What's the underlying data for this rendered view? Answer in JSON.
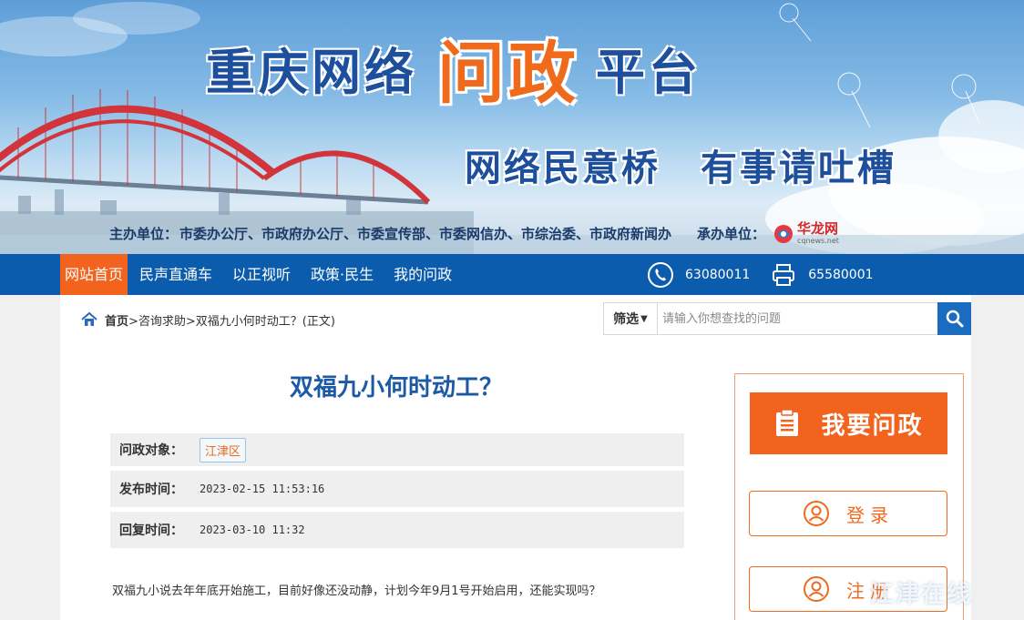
{
  "banner": {
    "title_part1": "重庆网络",
    "title_part2": "问政",
    "title_part3": "平台",
    "slogan_left": "网络民意桥",
    "slogan_right": "有事请吐槽",
    "host_label": "主办单位：",
    "host_units": "市委办公厅、市政府办公厅、市委宣传部、市委网信办、市综治委、市政府新闻办",
    "organizer_label": "承办单位：",
    "organizer_logo_cn": "华龙网",
    "organizer_logo_en": "cqnews.net"
  },
  "nav": {
    "items": [
      {
        "label": "网站首页"
      },
      {
        "label": "民声直通车"
      },
      {
        "label": "以正视听"
      },
      {
        "label": "政策·民生"
      },
      {
        "label": "我的问政"
      }
    ],
    "phone_icon": "phone-icon",
    "phone": "63080011",
    "fax_icon": "fax-icon",
    "fax": "65580001"
  },
  "breadcrumb": {
    "home": "首页",
    "rest": ">咨询求助>双福九小何时动工？(正文)"
  },
  "search": {
    "filter_label": "筛选",
    "placeholder": "请输入你想查找的问题",
    "value": ""
  },
  "question": {
    "title": "双福九小何时动工？",
    "target_label": "问政对象：",
    "target_value": "江津区",
    "published_label": "发布时间：",
    "published_value": "2023-02-15 11:53:16",
    "reply_label": "回复时间：",
    "reply_value": "2023-03-10 11:32",
    "body": "双福九小说去年年底开始施工，目前好像还没动静，计划今年9月1号开始启用，还能实现吗？"
  },
  "sidebar": {
    "ask_label": "我要问政",
    "login_label": "登录",
    "register_label": "注册"
  },
  "watermark": "江津在线",
  "colors": {
    "nav_blue": "#0c5cae",
    "accent_orange": "#f2641e",
    "title_blue": "#1c5aa6"
  }
}
